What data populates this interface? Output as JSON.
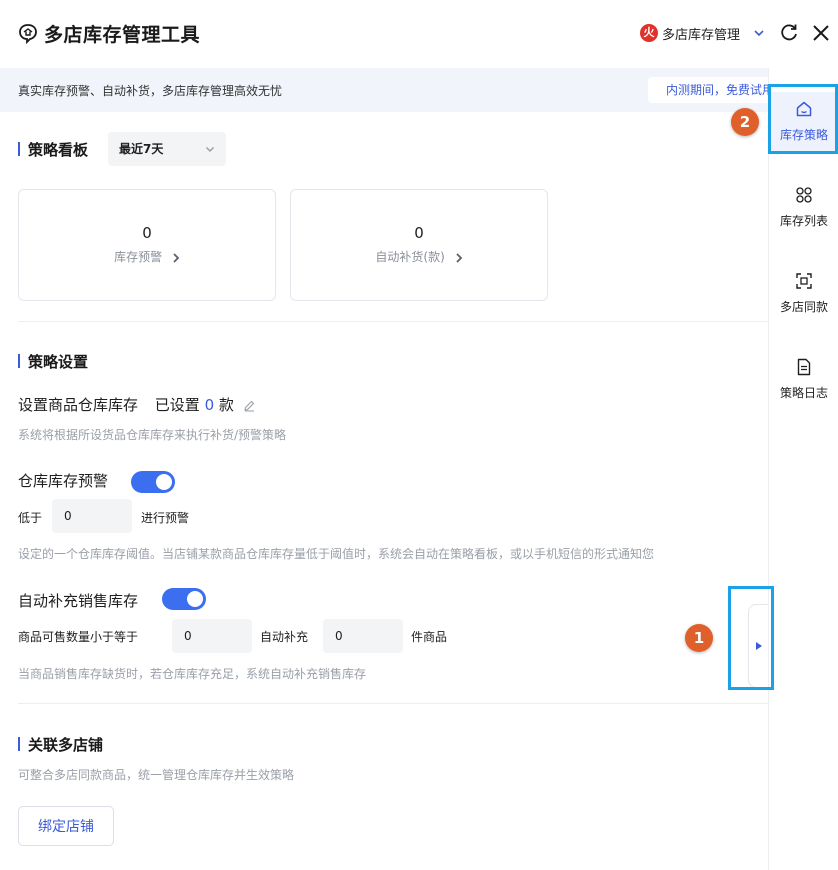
{
  "header": {
    "title": "多店库存管理工具",
    "store_badge": "火",
    "store_name": "多店库存管理"
  },
  "banner": {
    "text": "真实库存预警、自动补货，多店库存管理高效无忧",
    "beta_tag": "内测期间，免费试用"
  },
  "dashboard": {
    "title": "策略看板",
    "range": "最近7天",
    "cards": [
      {
        "value": "0",
        "label": "库存预警"
      },
      {
        "value": "0",
        "label": "自动补货(款)"
      }
    ]
  },
  "settings": {
    "title": "策略设置",
    "warehouse": {
      "label": "设置商品仓库库存",
      "configured_prefix": "已设置",
      "configured_count": "0",
      "configured_suffix": "款",
      "hint": "系统将根据所设货品仓库库存来执行补货/预警策略"
    },
    "alert": {
      "label": "仓库库存预警",
      "enabled": true,
      "below_label": "低于",
      "threshold": "0",
      "after_label": "进行预警",
      "hint": "设定的一个仓库库存阈值。当店铺某款商品仓库库存量低于阈值时，系统会自动在策略看板，或以手机短信的形式通知您"
    },
    "restock": {
      "label": "自动补充销售库存",
      "enabled": true,
      "qty_label": "商品可售数量小于等于",
      "qty_value": "0",
      "auto_label": "自动补充",
      "auto_value": "0",
      "unit_label": "件商品",
      "hint": "当商品销售库存缺货时，若仓库库存充足，系统自动补充销售库存"
    }
  },
  "linked": {
    "title": "关联多店铺",
    "hint": "可整合多店同款商品，统一管理仓库库存并生效策略",
    "bind_button": "绑定店铺"
  },
  "sidebar": {
    "items": [
      {
        "label": "库存策略",
        "icon": "home-icon",
        "active": true
      },
      {
        "label": "库存列表",
        "icon": "grid-icon",
        "active": false
      },
      {
        "label": "多店同款",
        "icon": "scan-icon",
        "active": false
      },
      {
        "label": "策略日志",
        "icon": "document-icon",
        "active": false
      }
    ]
  },
  "annotations": {
    "marker_1": "1",
    "marker_2": "2"
  },
  "colors": {
    "accent": "#3b5bdb",
    "toggle_on": "#3b6ff0",
    "highlight": "#1aa1e6",
    "marker": "#e0602b",
    "badge": "#e0322b"
  }
}
